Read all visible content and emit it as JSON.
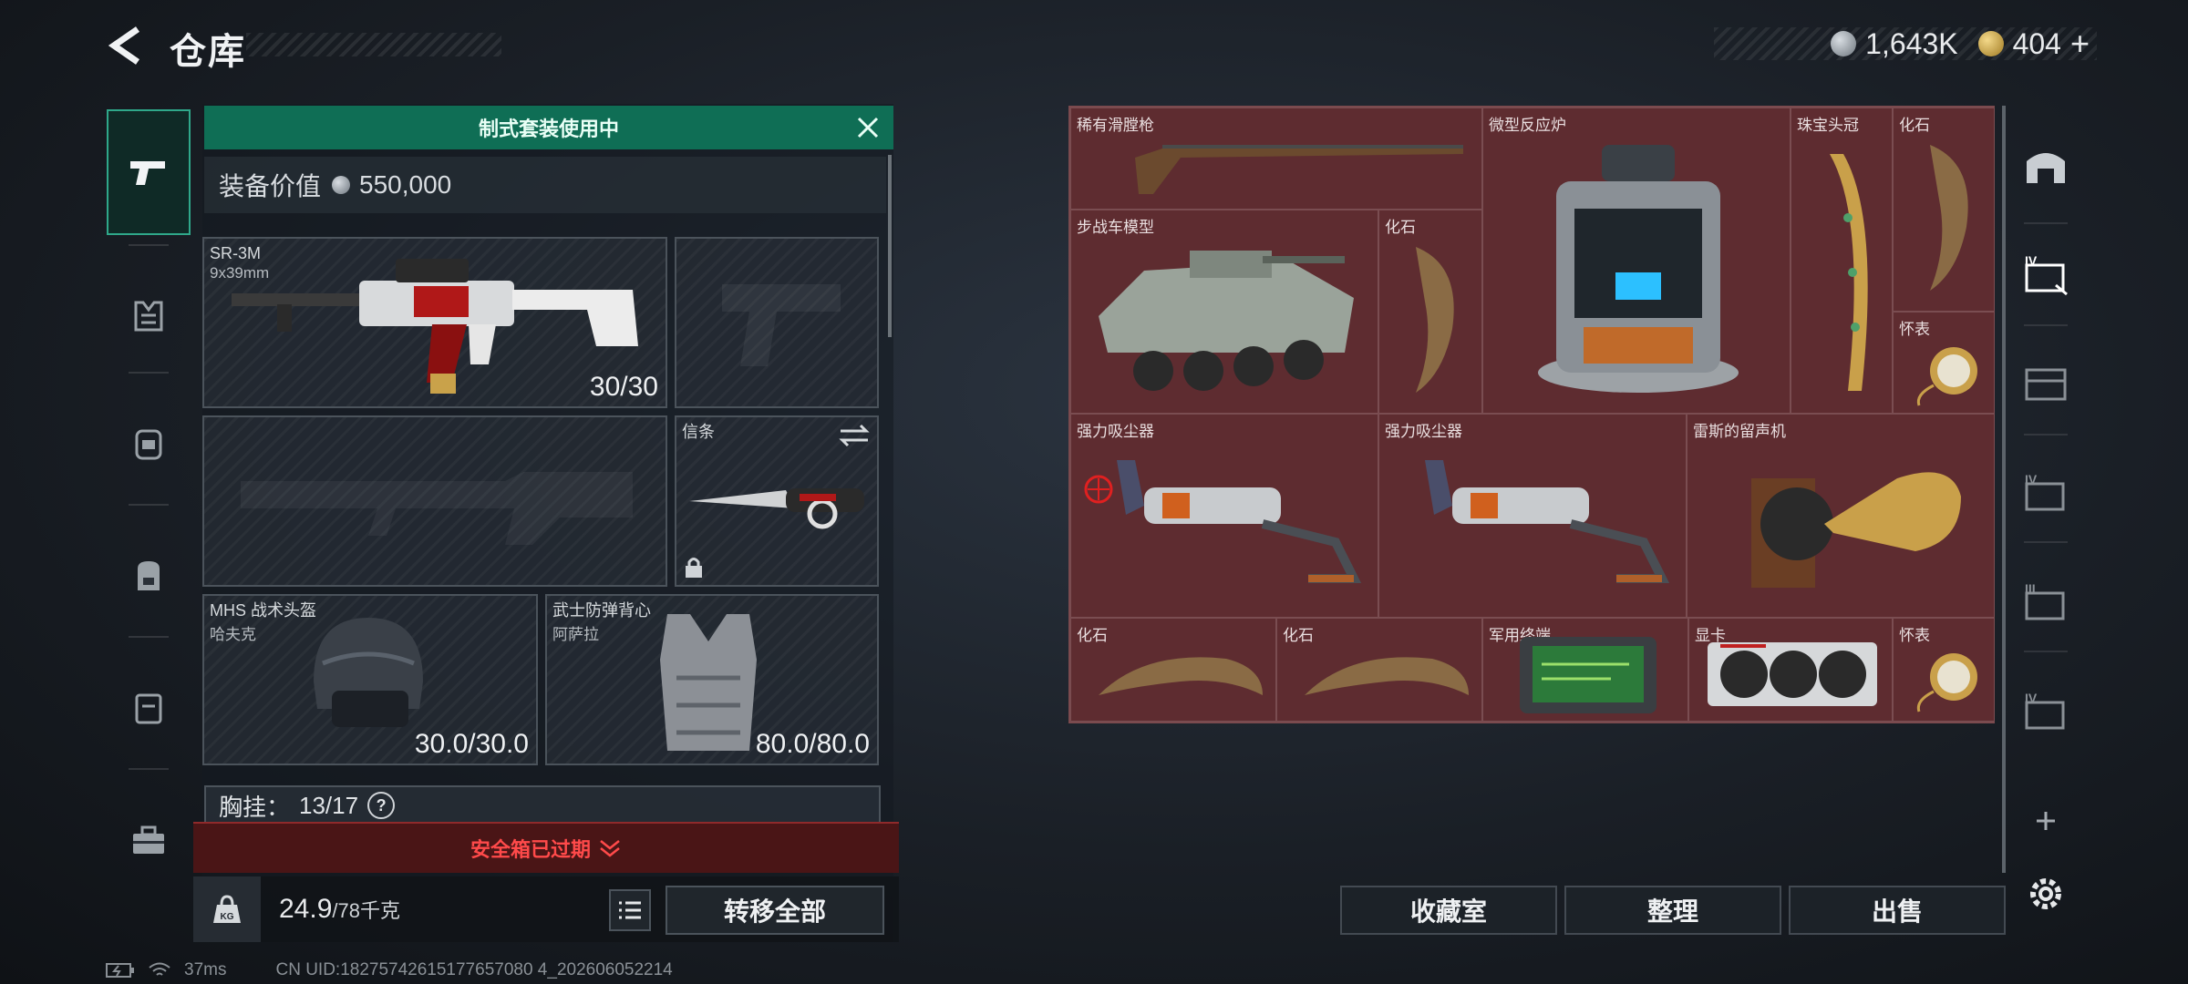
{
  "header": {
    "title": "仓库",
    "currency_silver": "1,643K",
    "currency_gold": "404",
    "add_currency_label": "+"
  },
  "loadout": {
    "banner": "制式套装使用中",
    "value_label": "装备价值",
    "value": "550,000",
    "primary_weapon": {
      "name": "SR-3M",
      "caliber": "9x39mm",
      "ammo": "30/30"
    },
    "melee": {
      "name": "信条"
    },
    "helmet": {
      "name": "MHS 战术头盔",
      "sub": "哈夫克",
      "durability": "30.0/30.0"
    },
    "armor": {
      "name": "武士防弹背心",
      "sub": "阿萨拉",
      "durability": "80.0/80.0"
    },
    "chest_rig_label": "胸挂：",
    "chest_rig_capacity": "13/17",
    "safe_box_status": "安全箱已过期",
    "weight_value": "24.9",
    "weight_capacity": "/78千克",
    "weight_icon_text": "KG",
    "transfer_all": "转移全部"
  },
  "storage": {
    "items": [
      {
        "label": "稀有滑膛枪"
      },
      {
        "label": "微型反应炉"
      },
      {
        "label": "珠宝头冠"
      },
      {
        "label": "化石"
      },
      {
        "label": "步战车模型"
      },
      {
        "label": "化石"
      },
      {
        "label": "怀表"
      },
      {
        "label": "强力吸尘器"
      },
      {
        "label": "强力吸尘器"
      },
      {
        "label": "雷斯的留声机"
      },
      {
        "label": "化石"
      },
      {
        "label": "化石"
      },
      {
        "label": "军用终端"
      },
      {
        "label": "显卡"
      },
      {
        "label": "怀表"
      }
    ]
  },
  "actions": {
    "collection": "收藏室",
    "sort": "整理",
    "sell": "出售"
  },
  "status": {
    "ping": "37ms",
    "uid": "CN UID:18275742615177657080 4_202606052214"
  },
  "colors": {
    "accent_green": "#0f6e55",
    "storage_bg": "#5e2c30",
    "warning_red": "#ff4a4a"
  }
}
